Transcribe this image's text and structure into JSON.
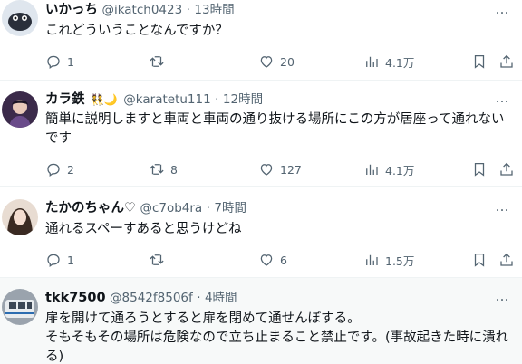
{
  "tweets": [
    {
      "name": "いかっち",
      "handle": "@ikatch0423",
      "dot": "·",
      "time": "13時間",
      "text": "これどういうことなんですか？",
      "replies": "1",
      "retweets": "",
      "likes": "20",
      "views": "4.1万"
    },
    {
      "name": "カラ鉄",
      "emoji": "👯🌙",
      "handle": "@karatetu111",
      "dot": "·",
      "time": "12時間",
      "text": "簡単に説明しますと車両と車両の通り抜ける場所にこの方が居座って通れないです",
      "replies": "2",
      "retweets": "8",
      "likes": "127",
      "views": "4.1万"
    },
    {
      "name": "たかのちゃん♡",
      "handle": "@c7ob4ra",
      "dot": "·",
      "time": "7時間",
      "text": "通れるスペーすあると思うけどね",
      "replies": "1",
      "retweets": "",
      "likes": "6",
      "views": "1.5万"
    },
    {
      "name": "tkk7500",
      "handle": "@8542f8506f",
      "dot": "·",
      "time": "4時間",
      "text": "扉を開けて通ろうとすると扉を閉めて通せんぼする。\nそもそもその場所は危険なので立ち止まること禁止です。(事故起きた時に潰れる)"
    }
  ],
  "more_icon": "…",
  "colors": {
    "text": "#0f1419",
    "secondary": "#536471",
    "divider": "#eff3f4",
    "highlight_bg": "#f7f9f9"
  },
  "icons": [
    "reply-icon",
    "retweet-icon",
    "like-icon",
    "views-icon",
    "bookmark-icon",
    "share-icon",
    "more-icon"
  ]
}
